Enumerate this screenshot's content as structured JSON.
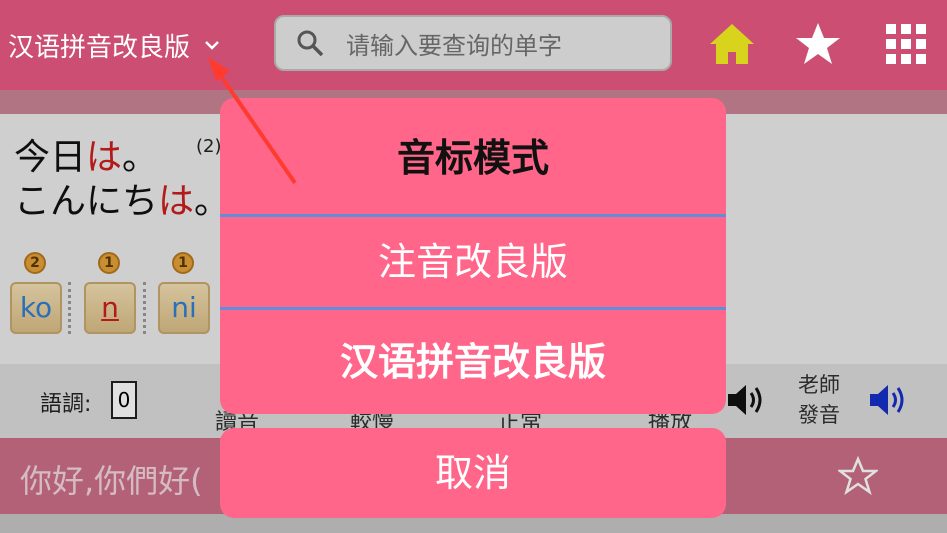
{
  "app": {
    "mode_label": "汉语拼音改良版",
    "search_placeholder": "请输入要查询的单字",
    "icons": [
      "home-icon",
      "star-icon",
      "grid-menu-icon"
    ]
  },
  "content": {
    "line1_prefix": "今日",
    "line1_red": "は",
    "line1_suffix": "。",
    "line1_note": "(2)",
    "line2_prefix": "こんにち",
    "line2_red": "は",
    "line2_suffix": "。",
    "tiles": [
      {
        "badge": "2",
        "kana": "ko"
      },
      {
        "badge": "1",
        "kana": "n"
      },
      {
        "badge": "1",
        "kana": "ni"
      }
    ]
  },
  "toolbar": {
    "tone_label": "語調:",
    "tone_value": "0",
    "items": [
      "讀音",
      "較慢",
      "正常",
      "播放"
    ],
    "teacher_line1": "老師",
    "teacher_line2": "發音"
  },
  "input_bar": {
    "text": "你好,你們好("
  },
  "dialog": {
    "title": "音标模式",
    "option_1": "注音改良版",
    "option_2": "汉语拼音改良版",
    "cancel": "取消"
  },
  "colors": {
    "topbar": "#cc4f73",
    "dialog": "#ff6689",
    "divider": "#5f8fdc",
    "home_icon": "#d8d31c",
    "speaker_blue": "#1530c8",
    "highlight_red": "#cc1f1f"
  }
}
